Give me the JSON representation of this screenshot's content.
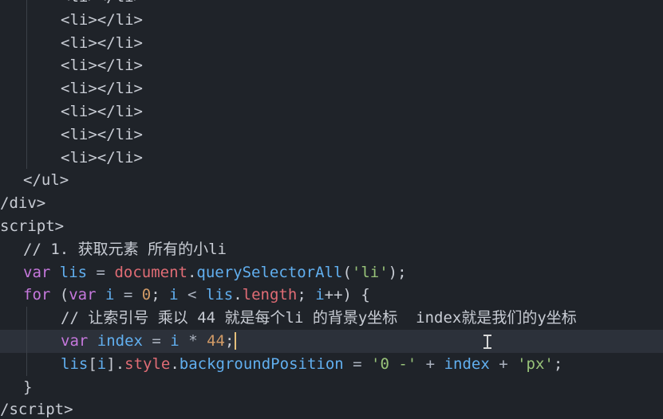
{
  "editor": {
    "lines": {
      "l0": "<li></li>",
      "l1": "<li></li>",
      "l2": "<li></li>",
      "l3": "<li></li>",
      "l4": "<li></li>",
      "l5": "<li></li>",
      "l6": "<li></li>",
      "l7": "<li></li>",
      "l8": "</ul>",
      "l9": "/div>",
      "l10": "script>",
      "l11": "// 1. 获取元素 所有的小li",
      "l12": {
        "kw": "var",
        "name": "lis",
        "eq": " = ",
        "obj": "document",
        "dot": ".",
        "fn": "querySelectorAll",
        "open": "(",
        "str": "'li'",
        "close": ");"
      },
      "l13": {
        "kw1": "for",
        "p1": " (",
        "kw2": "var",
        "v1": " i",
        "eq": " = ",
        "num": "0",
        "semi1": "; ",
        "v2": "i",
        "lt": " < ",
        "v3": "lis",
        "dot": ".",
        "prop": "length",
        "semi2": "; ",
        "v4": "i",
        "inc": "++) {"
      },
      "l14": "// 让索引号 乘以 44 就是每个li 的背景y坐标  index就是我们的y坐标",
      "l15": {
        "kw": "var",
        "name": " index",
        "eq": " = ",
        "v": "i",
        "op": " * ",
        "num": "44",
        "semi": ";"
      },
      "l16": {
        "v1": "lis",
        "b1": "[",
        "v2": "i",
        "b2": "]",
        "dot1": ".",
        "p1": "style",
        "dot2": ".",
        "p2": "backgroundPosition",
        "eq": " = ",
        "s1": "'0 -'",
        "plus1": " + ",
        "v3": "index",
        "plus2": " + ",
        "s2": "'px'",
        "semi": ";"
      },
      "l17": "}",
      "l18": "/script>"
    }
  }
}
